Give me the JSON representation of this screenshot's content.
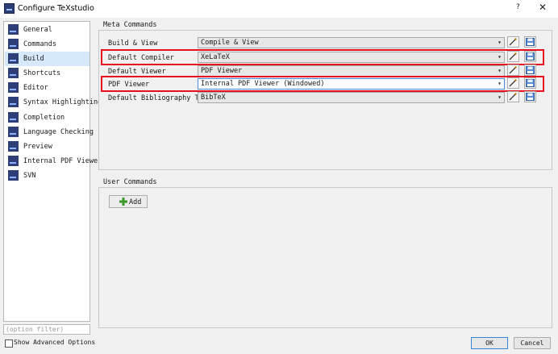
{
  "window": {
    "title": "Configure TeXstudio",
    "help": "?",
    "close": "✕"
  },
  "sidebar": {
    "items": [
      {
        "label": "General",
        "icon": "general-icon"
      },
      {
        "label": "Commands",
        "icon": "commands-icon"
      },
      {
        "label": "Build",
        "icon": "build-icon",
        "selected": true
      },
      {
        "label": "Shortcuts",
        "icon": "shortcuts-icon"
      },
      {
        "label": "Editor",
        "icon": "editor-icon"
      },
      {
        "label": "Syntax Highlighting",
        "icon": "syntax-icon"
      },
      {
        "label": "Completion",
        "icon": "completion-icon"
      },
      {
        "label": "Language Checking",
        "icon": "language-icon"
      },
      {
        "label": "Preview",
        "icon": "preview-icon"
      },
      {
        "label": "Internal PDF Viewer",
        "icon": "pdf-viewer-icon"
      },
      {
        "label": "SVN",
        "icon": "svn-icon"
      }
    ],
    "filter_placeholder": "(option filter)",
    "advanced_label": "Show Advanced Options"
  },
  "meta": {
    "title": "Meta Commands",
    "rows": [
      {
        "label": "Build & View",
        "value": "Compile & View"
      },
      {
        "label": "Default Compiler",
        "value": "XeLaTeX",
        "highlighted": true
      },
      {
        "label": "Default Viewer",
        "value": "PDF Viewer"
      },
      {
        "label": "PDF Viewer",
        "value": "Internal PDF Viewer (Windowed)",
        "highlighted": true,
        "active": true
      },
      {
        "label": "Default Bibliography Tool",
        "value": "BibTeX"
      }
    ]
  },
  "user": {
    "title": "User Commands",
    "add_label": "Add"
  },
  "footer": {
    "ok": "OK",
    "cancel": "Cancel"
  },
  "colors": {
    "highlight": "#e8101e",
    "selection": "#d6e8fb",
    "accent": "#3a84d6"
  }
}
